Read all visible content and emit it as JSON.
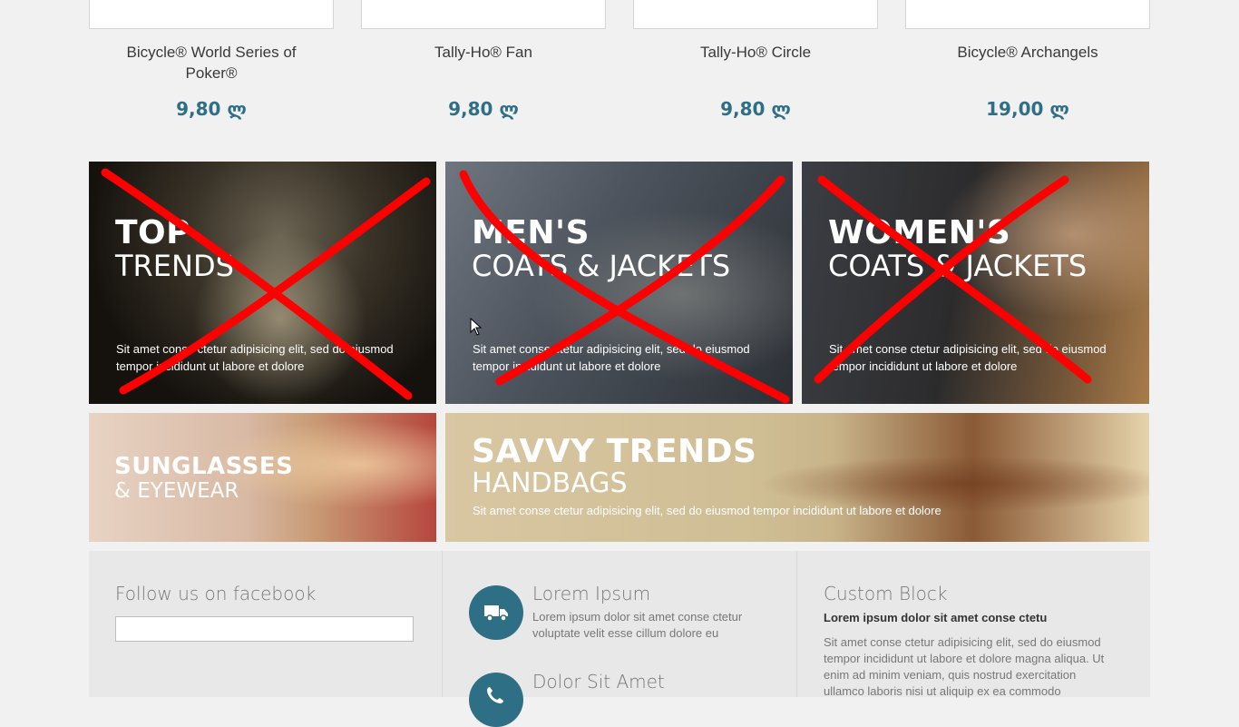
{
  "products": [
    {
      "name": "Bicycle® World Series of Poker®",
      "price": "9,80 ლ"
    },
    {
      "name": "Tally-Ho® Fan",
      "price": "9,80 ლ"
    },
    {
      "name": "Tally-Ho® Circle",
      "price": "9,80 ლ"
    },
    {
      "name": "Bicycle® Archangels",
      "price": "19,00 ლ"
    }
  ],
  "banners": {
    "top_trends": {
      "line1": "TOP",
      "line2": "TRENDS",
      "desc": "Sit amet conse ctetur adipisicing elit, sed do eiusmod tempor incididunt ut labore et dolore"
    },
    "mens": {
      "line1": "MEN'S",
      "line2": "COATS & JACKETS",
      "desc": "Sit amet conse ctetur adipisicing elit, sed do eiusmod tempor incididunt ut labore et dolore"
    },
    "womens": {
      "line1": "WOMEN'S",
      "line2": "COATS & JACKETS",
      "desc": "Sit amet conse ctetur adipisicing elit, sed do eiusmod tempor incididunt ut labore et dolore"
    },
    "sunglasses": {
      "line1": "SUNGLASSES",
      "line2": "& EYEWEAR"
    },
    "handbags": {
      "line1": "SAVVY TRENDS",
      "line2": "HANDBAGS",
      "desc": "Sit amet conse ctetur adipisicing elit, sed do eiusmod tempor incididunt ut labore et dolore"
    }
  },
  "footer": {
    "facebook": {
      "title": "Follow us on facebook"
    },
    "info": [
      {
        "title": "Lorem Ipsum",
        "text": "Lorem ipsum dolor sit amet conse ctetur voluptate velit esse cillum dolore eu",
        "icon": "truck-icon"
      },
      {
        "title": "Dolor Sit Amet",
        "icon": "phone-icon"
      }
    ],
    "custom": {
      "title": "Custom Block",
      "subtitle": "Lorem ipsum dolor sit amet conse ctetu",
      "text": "Sit amet conse ctetur adipisicing elit, sed do eiusmod tempor incididunt ut labore et dolore magna aliqua. Ut enim ad minim veniam, quis nostrud exercitation ullamco laboris nisi ut aliquip ex ea commodo"
    }
  },
  "colors": {
    "accent": "#2e6f85",
    "cross": "#ff0000"
  }
}
